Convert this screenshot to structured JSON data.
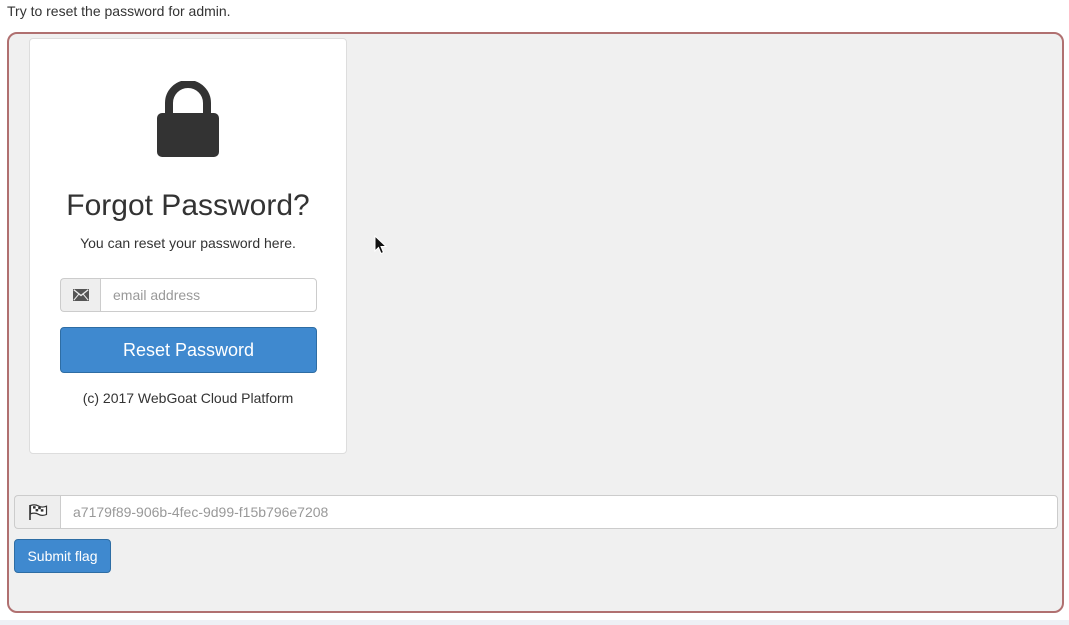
{
  "instruction": "Try to reset the password for admin.",
  "card": {
    "icon": "lock-icon",
    "title": "Forgot Password?",
    "subtitle": "You can reset your password here.",
    "email_icon": "envelope-icon",
    "email_placeholder": "email address",
    "email_value": "",
    "reset_button_label": "Reset Password",
    "copyright": "(c) 2017 WebGoat Cloud Platform"
  },
  "flag": {
    "icon": "flag-icon",
    "placeholder": "a7179f89-906b-4fec-9d99-f15b796e7208",
    "value": "",
    "submit_label": "Submit flag"
  },
  "colors": {
    "primary": "#3f89cf",
    "frame_border": "#b07070",
    "frame_background": "#f0f0f0"
  }
}
